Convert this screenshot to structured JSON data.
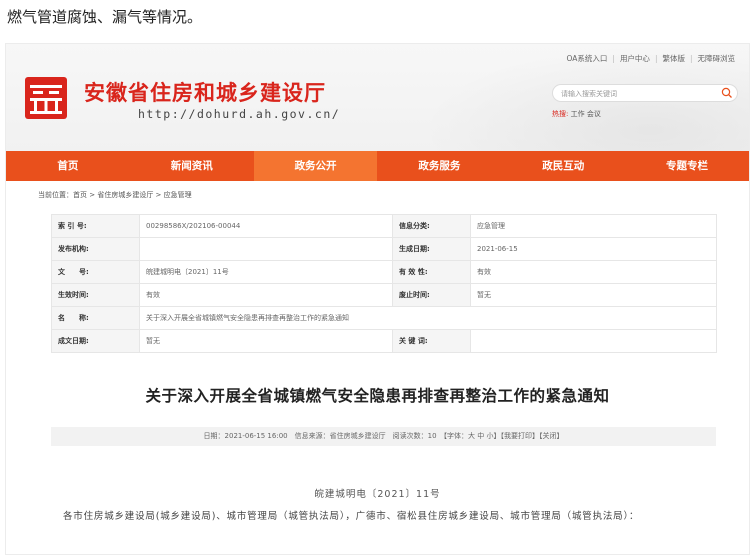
{
  "caption": "燃气管道腐蚀、漏气等情况。",
  "header": {
    "top_links": [
      "OA系统入口",
      "用户中心",
      "繁体版",
      "无障碍浏览"
    ],
    "title": "安徽省住房和城乡建设厅",
    "url": "http://dohurd.ah.gov.cn/",
    "search_placeholder": "请输入搜索关键词",
    "hot_label": "热搜:",
    "hot_words": [
      "工作",
      "会议"
    ]
  },
  "nav": [
    {
      "label": "首页"
    },
    {
      "label": "新闻资讯"
    },
    {
      "label": "政务公开"
    },
    {
      "label": "政务服务"
    },
    {
      "label": "政民互动"
    },
    {
      "label": "专题专栏"
    }
  ],
  "breadcrumb": "当前位置：首页 > 省住房城乡建设厅 > 应急管理",
  "info": {
    "index_label": "索 引 号:",
    "index_value": "00298586X/202106-00044",
    "category_label": "信息分类:",
    "category_value": "应急管理",
    "publisher_label": "发布机构:",
    "publisher_value": "",
    "created_label": "生成日期:",
    "created_value": "2021-06-15",
    "docno_label": "文　　号:",
    "docno_value": "皖建城明电〔2021〕11号",
    "validity_label": "有 效 性:",
    "validity_value": "有效",
    "effective_label": "生效时间:",
    "effective_value": "有效",
    "expire_label": "废止时间:",
    "expire_value": "暂无",
    "name_label": "名　　称:",
    "name_value": "关于深入开展全省城镇燃气安全隐患再排查再整治工作的紧急通知",
    "written_label": "成文日期:",
    "written_value": "暂无",
    "keyword_label": "关 键 词:",
    "keyword_value": ""
  },
  "document": {
    "title": "关于深入开展全省城镇燃气安全隐患再排查再整治工作的紧急通知",
    "meta": "日期：2021-06-15 16:00　信息来源：省住房城乡建设厅　阅读次数：10　【字体：大 中 小】【我要打印】【关闭】",
    "doc_no": "皖建城明电〔2021〕11号",
    "body": "各市住房城乡建设局(城乡建设局)、城市管理局（城管执法局），广德市、宿松县住房城乡建设局、城市管理局（城管执法局）："
  },
  "colors": {
    "nav_bg": "#e9501c",
    "nav_active": "#f47430",
    "title_red": "#d9251c"
  }
}
